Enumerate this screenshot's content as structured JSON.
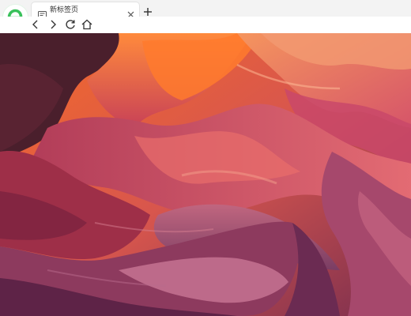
{
  "browser": {
    "logo_icon": "browser-e-logo",
    "tab": {
      "title": "新标签页",
      "icon": "new-tab-page-icon",
      "close_icon": "close-icon"
    },
    "new_tab_icon": "plus-icon",
    "toolbar": {
      "back_icon": "chevron-left-icon",
      "forward_icon": "chevron-right-icon",
      "refresh_icon": "refresh-icon",
      "home_icon": "home-icon"
    },
    "accent_color": "#39c15b"
  },
  "page": {
    "background": "canyon-wallpaper"
  }
}
